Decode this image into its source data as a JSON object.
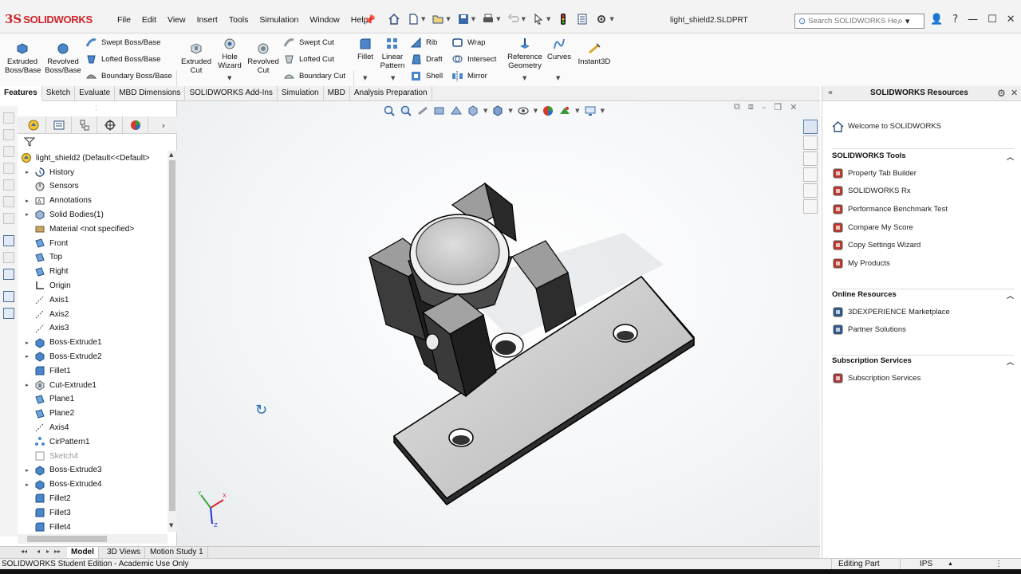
{
  "app": {
    "logo_ds": "3S",
    "logo_text": "SOLIDWORKS",
    "document_title": "light_shield2.SLDPRT"
  },
  "menu": [
    "File",
    "Edit",
    "View",
    "Insert",
    "Tools",
    "Simulation",
    "Window",
    "Help"
  ],
  "search": {
    "placeholder": "Search SOLIDWORKS Help"
  },
  "ribbon": {
    "extruded_boss": "Extruded\nBoss/Base",
    "revolved_boss": "Revolved\nBoss/Base",
    "swept_boss": "Swept Boss/Base",
    "lofted_boss": "Lofted Boss/Base",
    "boundary_boss": "Boundary Boss/Base",
    "extruded_cut": "Extruded\nCut",
    "hole_wizard": "Hole\nWizard",
    "revolved_cut": "Revolved\nCut",
    "swept_cut": "Swept Cut",
    "lofted_cut": "Lofted Cut",
    "boundary_cut": "Boundary Cut",
    "fillet": "Fillet",
    "linear_pattern": "Linear\nPattern",
    "rib": "Rib",
    "draft": "Draft",
    "shell": "Shell",
    "wrap": "Wrap",
    "intersect": "Intersect",
    "mirror": "Mirror",
    "reference_geometry": "Reference\nGeometry",
    "curves": "Curves",
    "instant3d": "Instant3D"
  },
  "command_tabs": [
    "Features",
    "Sketch",
    "Evaluate",
    "MBD Dimensions",
    "SOLIDWORKS Add-Ins",
    "Simulation",
    "MBD",
    "Analysis Preparation"
  ],
  "feature_tree": {
    "root": "light_shield2  (Default<<Default>",
    "items": [
      {
        "label": "History",
        "icon": "history",
        "expand": true
      },
      {
        "label": "Sensors",
        "icon": "sensor",
        "expand": false
      },
      {
        "label": "Annotations",
        "icon": "annotation",
        "expand": true
      },
      {
        "label": "Solid Bodies(1)",
        "icon": "solid",
        "expand": true
      },
      {
        "label": "Material <not specified>",
        "icon": "material",
        "expand": false
      },
      {
        "label": "Front",
        "icon": "plane",
        "expand": false
      },
      {
        "label": "Top",
        "icon": "plane",
        "expand": false
      },
      {
        "label": "Right",
        "icon": "plane",
        "expand": false
      },
      {
        "label": "Origin",
        "icon": "origin",
        "expand": false
      },
      {
        "label": "Axis1",
        "icon": "axis",
        "expand": false
      },
      {
        "label": "Axis2",
        "icon": "axis",
        "expand": false
      },
      {
        "label": "Axis3",
        "icon": "axis",
        "expand": false
      },
      {
        "label": "Boss-Extrude1",
        "icon": "extrude",
        "expand": true
      },
      {
        "label": "Boss-Extrude2",
        "icon": "extrude",
        "expand": true
      },
      {
        "label": "Fillet1",
        "icon": "fillet",
        "expand": false
      },
      {
        "label": "Cut-Extrude1",
        "icon": "cut",
        "expand": true
      },
      {
        "label": "Plane1",
        "icon": "plane",
        "expand": false
      },
      {
        "label": "Plane2",
        "icon": "plane",
        "expand": false
      },
      {
        "label": "Axis4",
        "icon": "axis",
        "expand": false
      },
      {
        "label": "CirPattern1",
        "icon": "pattern",
        "expand": false
      },
      {
        "label": "Sketch4",
        "icon": "sketch",
        "expand": false,
        "dim": true
      },
      {
        "label": "Boss-Extrude3",
        "icon": "extrude",
        "expand": true
      },
      {
        "label": "Boss-Extrude4",
        "icon": "extrude",
        "expand": true
      },
      {
        "label": "Fillet2",
        "icon": "fillet",
        "expand": false
      },
      {
        "label": "Fillet3",
        "icon": "fillet",
        "expand": false
      },
      {
        "label": "Fillet4",
        "icon": "fillet",
        "expand": false
      }
    ]
  },
  "resources": {
    "title": "SOLIDWORKS Resources",
    "welcome": "Welcome to SOLIDWORKS",
    "tools_header": "SOLIDWORKS Tools",
    "tools": [
      "Property Tab Builder",
      "SOLIDWORKS Rx",
      "Performance Benchmark Test",
      "Compare My Score",
      "Copy Settings Wizard",
      "My Products"
    ],
    "online_header": "Online Resources",
    "online": [
      "3DEXPERIENCE Marketplace",
      "Partner Solutions"
    ],
    "subscription_header": "Subscription Services",
    "subscription": [
      "Subscription Services"
    ]
  },
  "bottom_tabs": [
    "Model",
    "3D Views",
    "Motion Study 1"
  ],
  "status": {
    "edition": "SOLIDWORKS Student Edition - Academic Use Only",
    "mode": "Editing Part",
    "units": "IPS"
  },
  "colors": {
    "brand": "#d02429",
    "accent": "#2a6ebd",
    "model_top": "#c9c9c9",
    "model_side": "#3d3d3d"
  }
}
